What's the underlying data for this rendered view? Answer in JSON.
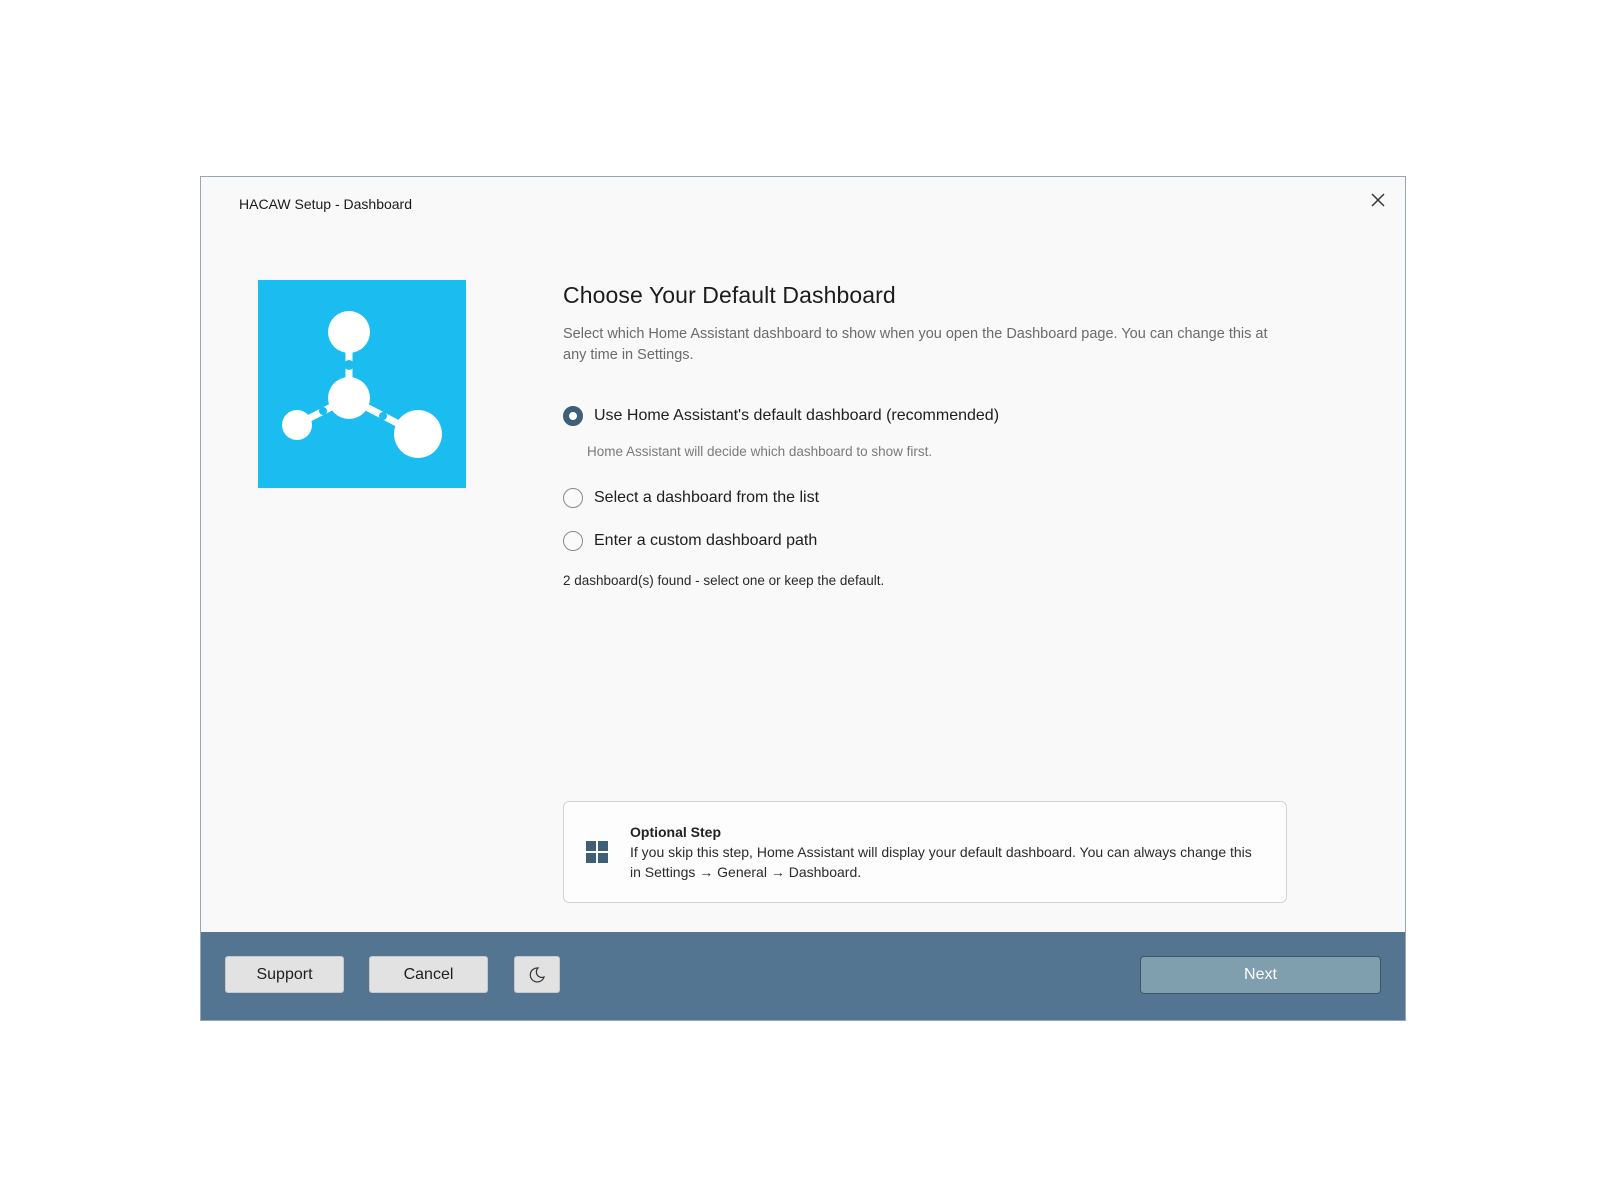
{
  "window": {
    "title": "HACAW Setup - Dashboard"
  },
  "main": {
    "heading": "Choose Your Default Dashboard",
    "description": "Select which Home Assistant dashboard to show when you open the Dashboard page. You can change this at any time in Settings.",
    "options": [
      {
        "label": "Use Home Assistant's default dashboard (recommended)",
        "selected": true,
        "hint": "Home Assistant will decide which dashboard to show first."
      },
      {
        "label": "Select a dashboard from the list",
        "selected": false
      },
      {
        "label": "Enter a custom dashboard path",
        "selected": false
      }
    ],
    "status": "2 dashboard(s) found - select one or keep the default."
  },
  "info_card": {
    "title": "Optional Step",
    "text": "If you skip this step, Home Assistant will display your default dashboard. You can always change this in Settings → General → Dashboard."
  },
  "footer": {
    "support_label": "Support",
    "cancel_label": "Cancel",
    "theme_icon": "moon-icon",
    "next_label": "Next"
  },
  "colors": {
    "logo_bg": "#1bbcf0",
    "footer_bg": "#537591",
    "radio_accent": "#3f5e78",
    "next_bg": "#7f9eae"
  }
}
